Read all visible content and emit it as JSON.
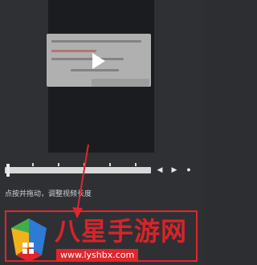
{
  "player": {
    "play_icon": "play-icon"
  },
  "timeline": {
    "controls": [
      "◀",
      "▶",
      "●"
    ]
  },
  "hint": {
    "text": "点按并拖动，调整视频长度"
  },
  "colors": {
    "highlight": "#e0262d",
    "watermark_red": "#d9232a"
  },
  "watermark": {
    "title": "八星手游网",
    "url": "www.lyshbx.com"
  }
}
